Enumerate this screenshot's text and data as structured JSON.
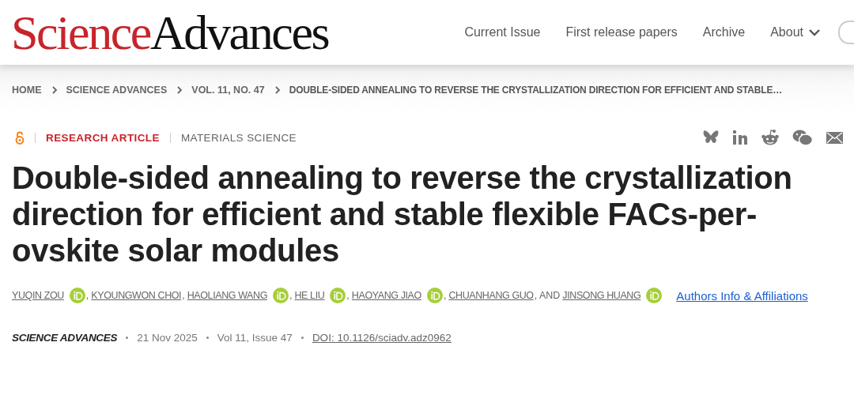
{
  "header": {
    "logo": [
      "Science",
      "Advances"
    ],
    "nav": [
      {
        "label": "Current Issue",
        "dropdown": false
      },
      {
        "label": "First release papers",
        "dropdown": false
      },
      {
        "label": "Archive",
        "dropdown": false
      },
      {
        "label": "About",
        "dropdown": true
      }
    ]
  },
  "breadcrumbs": [
    "HOME",
    "SCIENCE ADVANCES",
    "VOL. 11, NO. 47",
    "DOUBLE-SIDED ANNEALING TO REVERSE THE CRYSTALLIZATION DIRECTION FOR EFFICIENT AND STABLE…"
  ],
  "article": {
    "open_access": true,
    "type": "RESEARCH ARTICLE",
    "subject": "MATERIALS SCIENCE",
    "share": [
      {
        "kind": "bluesky"
      },
      {
        "kind": "linkedin"
      },
      {
        "kind": "reddit"
      },
      {
        "kind": "wechat"
      },
      {
        "kind": "email"
      }
    ],
    "title_lines": [
      "Double-sided annealing to reverse the crystallization",
      "direction for efficient and stable flexible FACs-per-",
      "ovskite solar modules"
    ],
    "authors": [
      {
        "name": "YUQIN ZOU",
        "orcid": true,
        "sep": ","
      },
      {
        "name": "KYOUNGWON CHOI",
        "orcid": false,
        "sep": ","
      },
      {
        "name": "HAOLIANG WANG",
        "orcid": true,
        "sep": ","
      },
      {
        "name": "HE LIU",
        "orcid": true,
        "sep": ","
      },
      {
        "name": "HAOYANG JIAO",
        "orcid": true,
        "sep": ","
      },
      {
        "name": "CHUANHANG GUO",
        "orcid": false,
        "sep": ", AND"
      },
      {
        "name": "JINSONG HUANG",
        "orcid": true
      }
    ],
    "affiliations_link": "Authors Info & Affiliations",
    "journal": "SCIENCE ADVANCES",
    "date": "21 Nov 2025",
    "volume": "Vol 11, Issue 47",
    "doi": "DOI: 10.1126/sciadv.adz0962"
  }
}
